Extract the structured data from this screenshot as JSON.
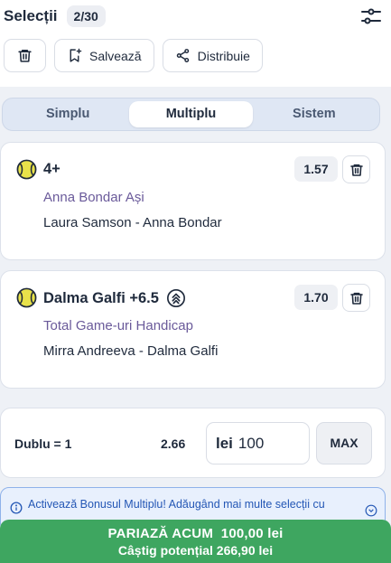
{
  "header": {
    "title": "Selecții",
    "count": "2/30",
    "settings_icon": "sliders-icon"
  },
  "actions": {
    "delete_icon": "trash-icon",
    "save_label": "Salvează",
    "share_label": "Distribuie"
  },
  "tabs": [
    {
      "label": "Simplu",
      "active": false
    },
    {
      "label": "Multiplu",
      "active": true
    },
    {
      "label": "Sistem",
      "active": false
    }
  ],
  "selections": [
    {
      "name": "4+",
      "odds": "1.57",
      "market": "Anna Bondar Ași",
      "match": "Laura Samson - Anna Bondar",
      "sport_icon": "tennis-ball-icon"
    },
    {
      "name": "Dalma Galfi +6.5",
      "odds": "1.70",
      "market": "Total Game-uri Handicap",
      "match": "Mirra Andreeva - Dalma Galfi",
      "sport_icon": "tennis-ball-icon",
      "badge_icon": "boost-icon"
    }
  ],
  "stake": {
    "bet_type": "Dublu = 1",
    "total_odds": "2.66",
    "currency": "lei",
    "amount": "100",
    "max_label": "MAX"
  },
  "bonus": {
    "text": "Activează Bonusul Multiplu! Adăugând mai multe selecții cu"
  },
  "place_bet": {
    "label": "PARIAZĂ ACUM  100,00 lei",
    "potential": "Câștig potențial 266,90 lei"
  },
  "colors": {
    "accent_green": "#3ea660",
    "tab_bg": "#dfe7f4",
    "market_text": "#6a5a9a",
    "info_blue": "#2457b5",
    "tennis_ball": "#e8e24a"
  }
}
